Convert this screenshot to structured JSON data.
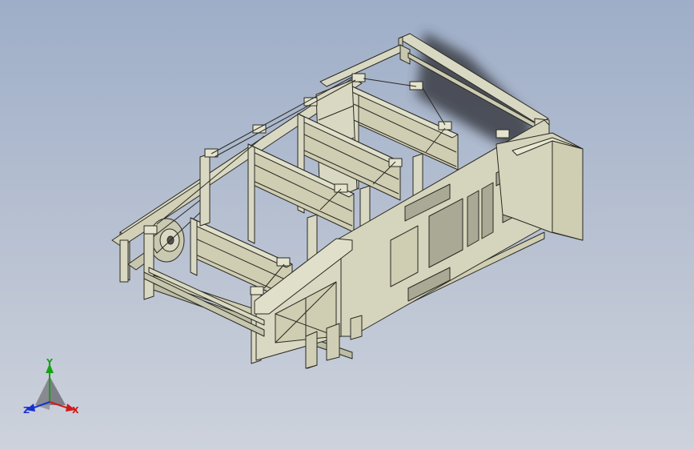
{
  "viewport": {
    "background_top": "#9eaec8",
    "background_bottom": "#cdd2dc"
  },
  "model": {
    "part_fill": "#d9d8c2",
    "panel_fill": "#cfcdb2",
    "edge_color": "#2a2a22",
    "shadow_color": "#3a3c44"
  },
  "triad": {
    "x_label": "X",
    "y_label": "Y",
    "z_label": "Z",
    "x_color": "#d01818",
    "y_color": "#18a018",
    "z_color": "#1830d0"
  }
}
